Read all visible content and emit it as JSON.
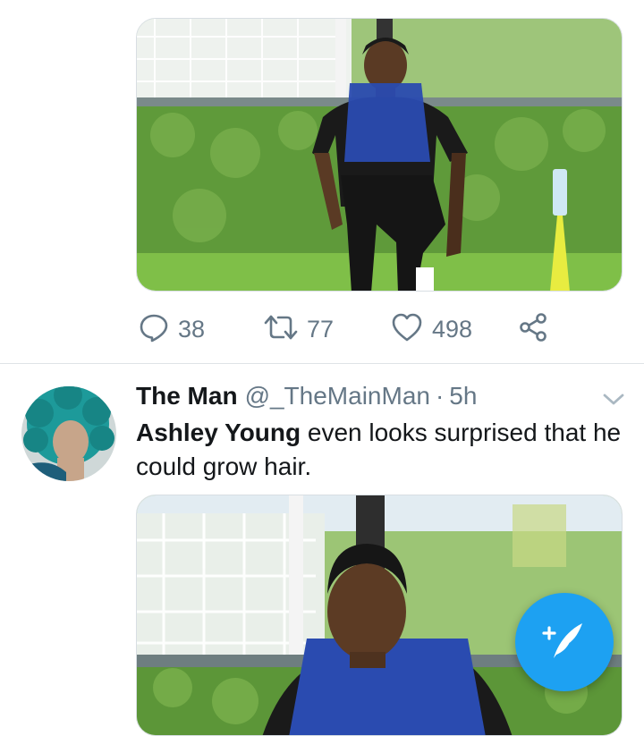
{
  "tweet1": {
    "media_alt": "photo",
    "replies": "38",
    "retweets": "77",
    "likes": "498"
  },
  "tweet2": {
    "name": "The Man",
    "handle": "@_TheMainMan",
    "separator": "·",
    "time": "5h",
    "text_bold": "Ashley Young",
    "text_rest": " even looks surprised that he could grow hair."
  },
  "colors": {
    "twitter_blue": "#1da1f2",
    "secondary_text": "#657786",
    "primary_text": "#14171a"
  },
  "icons": [
    "reply-icon",
    "retweet-icon",
    "like-icon",
    "share-icon",
    "chevron-down-icon",
    "compose-tweet-icon"
  ]
}
